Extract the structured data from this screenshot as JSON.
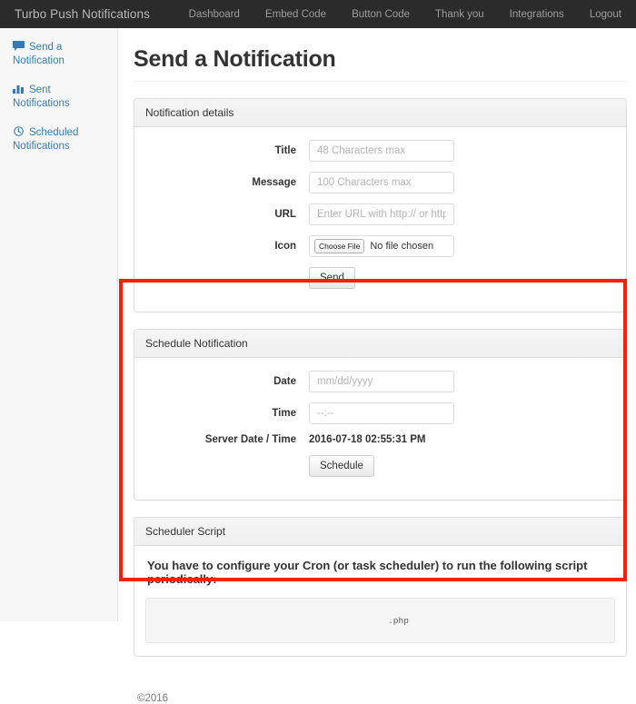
{
  "navbar": {
    "brand": "Turbo Push Notifications",
    "links": [
      {
        "label": "Dashboard"
      },
      {
        "label": "Embed Code"
      },
      {
        "label": "Button Code"
      },
      {
        "label": "Thank you"
      },
      {
        "label": "Integrations"
      },
      {
        "label": "Logout"
      }
    ]
  },
  "sidebar": {
    "items": [
      {
        "label": "Send a Notification",
        "icon": "comment-icon"
      },
      {
        "label": "Sent Notifications",
        "icon": "bar-chart-icon"
      },
      {
        "label": "Scheduled Notifications",
        "icon": "clock-icon"
      }
    ]
  },
  "main": {
    "page_title": "Send a Notification",
    "notification_details": {
      "heading": "Notification details",
      "fields": [
        {
          "label": "Title",
          "placeholder": "48 Characters max",
          "value": ""
        },
        {
          "label": "Message",
          "placeholder": "100 Characters max",
          "value": ""
        },
        {
          "label": "URL",
          "placeholder": "Enter URL with http:// or https://",
          "value": ""
        }
      ],
      "icon_field": {
        "label": "Icon",
        "button_label": "Choose File",
        "status_text": "No file chosen"
      },
      "submit_label": "Send"
    },
    "schedule_notification": {
      "heading": "Schedule Notification",
      "date": {
        "label": "Date",
        "placeholder": "mm/dd/yyyy",
        "value": ""
      },
      "time": {
        "label": "Time",
        "placeholder": "--:--",
        "value": ""
      },
      "server_time": {
        "label": "Server Date / Time",
        "value": "2016-07-18 02:55:31 PM"
      },
      "submit_label": "Schedule"
    },
    "scheduler_script": {
      "heading": "Scheduler Script",
      "lead": "You have to configure your Cron (or task scheduler) to run the following script periodically:",
      "script": ".php"
    }
  },
  "footer": {
    "copyright": "©2016"
  },
  "colors": {
    "navbar_bg": "#2b2b2b",
    "sidebar_link": "#337ab7",
    "highlight_border": "#f52100",
    "panel_border": "#dddddd"
  }
}
